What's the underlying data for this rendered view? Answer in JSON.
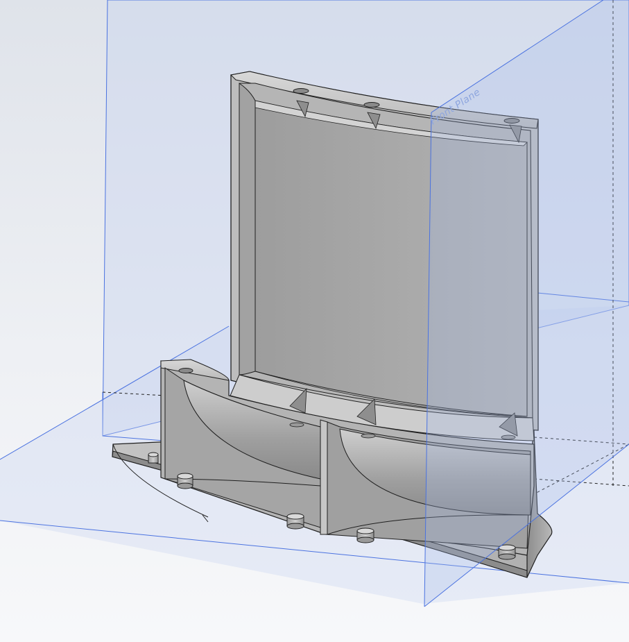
{
  "viewport": {
    "plane_label": "Front Plane"
  },
  "colors": {
    "background_top": "#dfe3ea",
    "background_bottom": "#f7f8fa",
    "plane_edge": "#4a72e0",
    "plane_fill": "#c9d4f0",
    "part_light": "#c8c8c8",
    "part_mid": "#a9a9a9",
    "part_dark": "#7a7a7a",
    "edge": "#1e1e1e"
  },
  "icons": [
    "front-plane-icon",
    "top-plane-icon",
    "right-plane-icon"
  ]
}
